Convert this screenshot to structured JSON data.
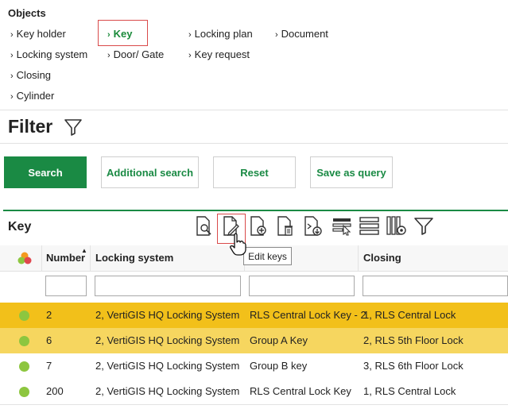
{
  "objects": {
    "title": "Objects",
    "links": [
      "Key holder",
      "Key",
      "Locking plan",
      "Document",
      "Locking system",
      "Door/ Gate",
      "Key request",
      "Closing",
      "Cylinder"
    ]
  },
  "filter": {
    "title": "Filter",
    "buttons": {
      "search": "Search",
      "additional": "Additional search",
      "reset": "Reset",
      "save_query": "Save as query"
    }
  },
  "key_section": {
    "title": "Key",
    "toolbar_icons": [
      "view-document-icon",
      "edit-document-icon",
      "add-document-icon",
      "delete-document-icon",
      "import-document-icon",
      "grid-settings-icon",
      "rows-icon",
      "columns-settings-icon",
      "filter-icon"
    ],
    "tooltip": "Edit keys"
  },
  "table": {
    "columns": [
      "Number",
      "Locking system",
      "",
      "Closing"
    ],
    "sort_indicator": "▲",
    "rows": [
      {
        "number": "2",
        "locking_system": "2, VertiGIS HQ Locking System",
        "name": "RLS Central Lock Key - 2",
        "closing": "1, RLS Central Lock",
        "highlight": "#f2c01a"
      },
      {
        "number": "6",
        "locking_system": "2, VertiGIS HQ Locking System",
        "name": "Group A Key",
        "closing": "2, RLS 5th Floor Lock",
        "highlight": "#f6d65f"
      },
      {
        "number": "7",
        "locking_system": "2, VertiGIS HQ Locking System",
        "name": "Group B key",
        "closing": "3, RLS 6th Floor Lock",
        "highlight": "#ffffff"
      },
      {
        "number": "200",
        "locking_system": "2, VertiGIS HQ Locking System",
        "name": "RLS Central Lock Key",
        "closing": "1, RLS Central Lock",
        "highlight": "#ffffff"
      }
    ]
  },
  "colors": {
    "accent": "#1a8a44",
    "status_dot": "#8dc63f",
    "highlight_box": "#d94a4a"
  }
}
